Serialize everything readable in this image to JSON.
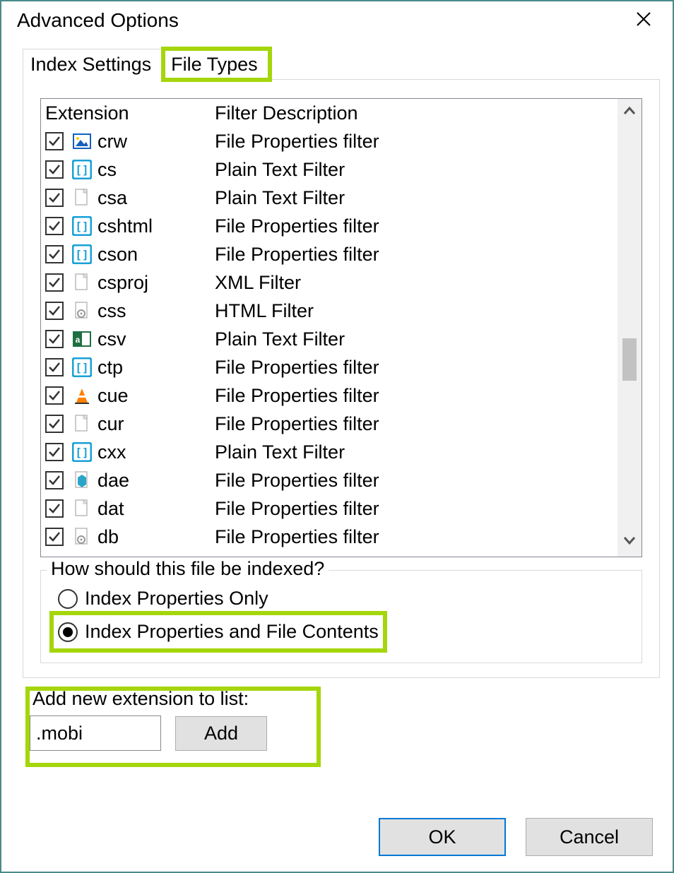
{
  "window": {
    "title": "Advanced Options"
  },
  "tabs": {
    "index_settings": "Index Settings",
    "file_types": "File Types"
  },
  "columns": {
    "ext": "Extension",
    "desc": "Filter Description"
  },
  "rows": [
    {
      "checked": true,
      "icon": "image",
      "ext": "crw",
      "desc": "File Properties filter"
    },
    {
      "checked": true,
      "icon": "bracket",
      "ext": "cs",
      "desc": "Plain Text Filter"
    },
    {
      "checked": true,
      "icon": "blank",
      "ext": "csa",
      "desc": "Plain Text Filter"
    },
    {
      "checked": true,
      "icon": "bracket",
      "ext": "cshtml",
      "desc": "File Properties filter"
    },
    {
      "checked": true,
      "icon": "bracket",
      "ext": "cson",
      "desc": "File Properties filter"
    },
    {
      "checked": true,
      "icon": "blank",
      "ext": "csproj",
      "desc": "XML Filter"
    },
    {
      "checked": true,
      "icon": "gear",
      "ext": "css",
      "desc": "HTML Filter"
    },
    {
      "checked": true,
      "icon": "excel",
      "ext": "csv",
      "desc": "Plain Text Filter"
    },
    {
      "checked": true,
      "icon": "bracket",
      "ext": "ctp",
      "desc": "File Properties filter"
    },
    {
      "checked": true,
      "icon": "cone",
      "ext": "cue",
      "desc": "File Properties filter"
    },
    {
      "checked": true,
      "icon": "blank",
      "ext": "cur",
      "desc": "File Properties filter"
    },
    {
      "checked": true,
      "icon": "bracket",
      "ext": "cxx",
      "desc": "Plain Text Filter"
    },
    {
      "checked": true,
      "icon": "doc3d",
      "ext": "dae",
      "desc": "File Properties filter"
    },
    {
      "checked": true,
      "icon": "blank",
      "ext": "dat",
      "desc": "File Properties filter"
    },
    {
      "checked": true,
      "icon": "gear",
      "ext": "db",
      "desc": "File Properties filter"
    }
  ],
  "group": {
    "legend": "How should this file be indexed?",
    "opt_properties": "Index Properties Only",
    "opt_contents": "Index Properties and File Contents",
    "selected": "contents"
  },
  "add": {
    "label": "Add new extension to list:",
    "value": ".mobi",
    "button": "Add"
  },
  "buttons": {
    "ok": "OK",
    "cancel": "Cancel"
  }
}
